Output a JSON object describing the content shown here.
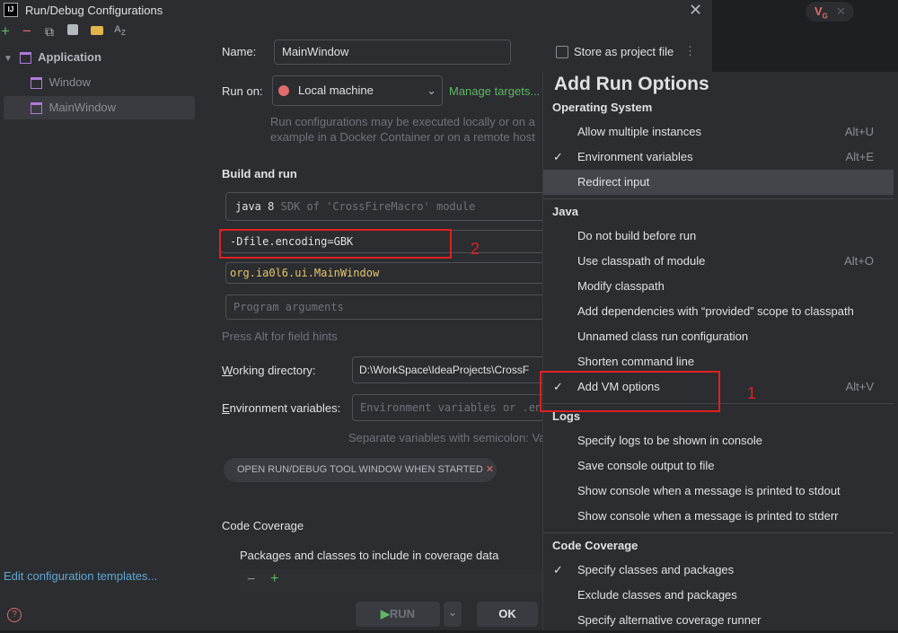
{
  "window": {
    "logo": "IJ",
    "title": "Run/Debug Configurations",
    "close": "✕"
  },
  "toolbar": {
    "add": "+",
    "remove": "−",
    "copy": "⧉",
    "save": "💾",
    "folder": "📁",
    "sort": "A̲Z"
  },
  "tree": {
    "group": "Application",
    "items": [
      {
        "label": "Window"
      },
      {
        "label": "MainWindow"
      }
    ]
  },
  "left_footer": {
    "edit_templates": "Edit configuration templates...",
    "help": "?"
  },
  "form": {
    "name_label": "Name:",
    "name_value": "MainWindow",
    "store_label": "Store as project file",
    "more": "⋮",
    "run_on_label": "Run on:",
    "run_on_value": "Local machine",
    "manage_targets": "Manage targets...",
    "run_on_hint_1": "Run configurations may be executed locally or on a",
    "run_on_hint_2": "example in a Docker Container or on a remote host",
    "build_run_title": "Build and run",
    "sdk_value": "java 8",
    "sdk_hint": "SDK of 'CrossFireMacro' module",
    "vm_options": "-Dfile.encoding=GBK",
    "main_class": "org.ia0l6.ui.MainWindow",
    "program_args_placeholder": "Program arguments",
    "alt_hint": "Press Alt for field hints",
    "working_dir_label": "Working directory:",
    "working_dir_value": "D:\\WorkSpace\\IdeaProjects\\CrossF",
    "env_label": "Environment variables:",
    "env_placeholder": "Environment variables or .env",
    "env_hint": "Separate variables with semicolon: Va",
    "open_tool_window": "OPEN RUN/DEBUG TOOL WINDOW WHEN STARTED",
    "chip_close": "✕",
    "code_coverage_title": "Code Coverage",
    "coverage_packages": "Packages and classes to include in coverage data",
    "cov_minus": "−",
    "cov_plus": "+"
  },
  "buttons": {
    "run": "RUN",
    "run_dropdown": "⌄",
    "ok": "OK"
  },
  "popup": {
    "title": "Add Run Options",
    "sections": [
      {
        "title": "Operating System",
        "options": [
          {
            "label": "Allow multiple instances",
            "shortcut": "Alt+U",
            "checked": false
          },
          {
            "label": "Environment variables",
            "shortcut": "Alt+E",
            "checked": true
          },
          {
            "label": "Redirect input",
            "shortcut": "",
            "checked": false,
            "selected": true
          }
        ]
      },
      {
        "title": "Java",
        "options": [
          {
            "label": "Do not build before run",
            "shortcut": "",
            "checked": false
          },
          {
            "label": "Use classpath of module",
            "shortcut": "Alt+O",
            "checked": false
          },
          {
            "label": "Modify classpath",
            "shortcut": "",
            "checked": false
          },
          {
            "label": "Add dependencies with “provided” scope to classpath",
            "shortcut": "",
            "checked": false
          },
          {
            "label": "Unnamed class run configuration",
            "shortcut": "",
            "checked": false
          },
          {
            "label": "Shorten command line",
            "shortcut": "",
            "checked": false
          },
          {
            "label": "Add VM options",
            "shortcut": "Alt+V",
            "checked": true
          }
        ]
      },
      {
        "title": "Logs",
        "options": [
          {
            "label": "Specify logs to be shown in console",
            "shortcut": "",
            "checked": false
          },
          {
            "label": "Save console output to file",
            "shortcut": "",
            "checked": false
          },
          {
            "label": "Show console when a message is printed to stdout",
            "shortcut": "",
            "checked": false
          },
          {
            "label": "Show console when a message is printed to stderr",
            "shortcut": "",
            "checked": false
          }
        ]
      },
      {
        "title": "Code Coverage",
        "options": [
          {
            "label": "Specify classes and packages",
            "shortcut": "",
            "checked": true
          },
          {
            "label": "Exclude classes and packages",
            "shortcut": "",
            "checked": false
          },
          {
            "label": "Specify alternative coverage runner",
            "shortcut": "",
            "checked": false
          }
        ]
      }
    ]
  },
  "annotations": {
    "box1": "1",
    "box2": "2"
  },
  "topright": {
    "badge": "V̲G",
    "close": "✕"
  },
  "colors": {
    "accent_green": "#5fb865",
    "selection": "#43454a",
    "highlight_row": "#2e436e",
    "annotation_red": "#e02020"
  }
}
